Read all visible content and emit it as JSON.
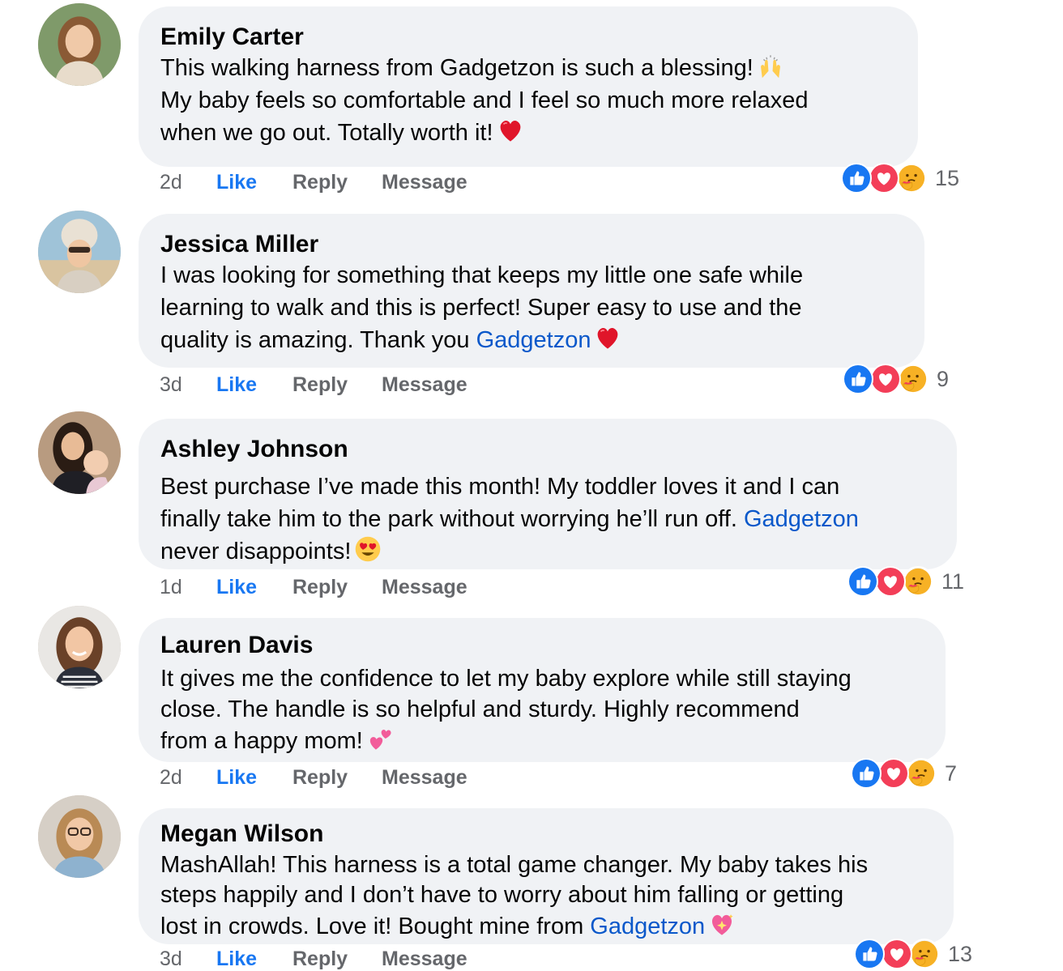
{
  "comments": [
    {
      "name": "Emily Carter",
      "lines": [
        "This walking harness from Gadgetzon is such a blessing!",
        "My baby feels so comfortable and I feel so much more relaxed",
        "when we go out. Totally worth it!"
      ],
      "line_emojis": [
        "raising-hands-emoji",
        "",
        "red-heart-emoji"
      ],
      "time": "2d",
      "like": "Like",
      "reply": "Reply",
      "message": "Message",
      "reaction_count": "15",
      "reaction_icons": [
        "like-reaction-icon",
        "love-reaction-icon",
        "care-reaction-icon"
      ]
    },
    {
      "name": "Jessica Miller",
      "lines": [
        "I was looking for something that keeps my little one safe while",
        "learning to walk and this is perfect! Super easy to use and the",
        "quality is amazing. Thank you"
      ],
      "link": "Gadgetzon",
      "line_emojis": [
        "",
        "",
        "red-heart-emoji"
      ],
      "time": "3d",
      "like": "Like",
      "reply": "Reply",
      "message": "Message",
      "reaction_count": "9",
      "reaction_icons": [
        "like-reaction-icon",
        "love-reaction-icon",
        "care-reaction-icon"
      ]
    },
    {
      "name": "Ashley Johnson",
      "lines": [
        "Best purchase I’ve made this month! My toddler loves it and I can",
        "finally take him to the park without worrying he’ll run off.",
        "never disappoints!"
      ],
      "link": "Gadgetzon",
      "line_emojis": [
        "",
        "",
        "heart-eyes-emoji"
      ],
      "time": "1d",
      "like": "Like",
      "reply": "Reply",
      "message": "Message",
      "reaction_count": "11",
      "reaction_icons": [
        "like-reaction-icon",
        "love-reaction-icon",
        "care-reaction-icon"
      ]
    },
    {
      "name": "Lauren Davis",
      "lines": [
        "It gives me the confidence to let my baby explore while still staying",
        "close. The handle is so helpful and sturdy. Highly recommend",
        "from a happy mom!"
      ],
      "line_emojis": [
        "",
        "",
        "two-hearts-emoji"
      ],
      "time": "2d",
      "like": "Like",
      "reply": "Reply",
      "message": "Message",
      "reaction_count": "7",
      "reaction_icons": [
        "like-reaction-icon",
        "love-reaction-icon",
        "care-reaction-icon"
      ]
    },
    {
      "name": "Megan Wilson",
      "lines": [
        "MashAllah! This harness is a total game changer. My baby takes his",
        "steps happily and I don’t have to worry about him falling or getting",
        "lost in crowds. Love it! Bought mine from"
      ],
      "link": "Gadgetzon",
      "line_emojis": [
        "",
        "",
        "sparkling-heart-emoji"
      ],
      "time": "3d",
      "like": "Like",
      "reply": "Reply",
      "message": "Message",
      "reaction_count": "13",
      "reaction_icons": [
        "like-reaction-icon",
        "love-reaction-icon",
        "care-reaction-icon"
      ]
    }
  ],
  "colors": {
    "bubble": "#f0f2f5",
    "link": "#0a58ca",
    "like_action": "#1877f2",
    "muted": "#65676b",
    "like_reaction": "#1877f2",
    "love_reaction": "#f33e58",
    "care_reaction": "#f7b125"
  }
}
